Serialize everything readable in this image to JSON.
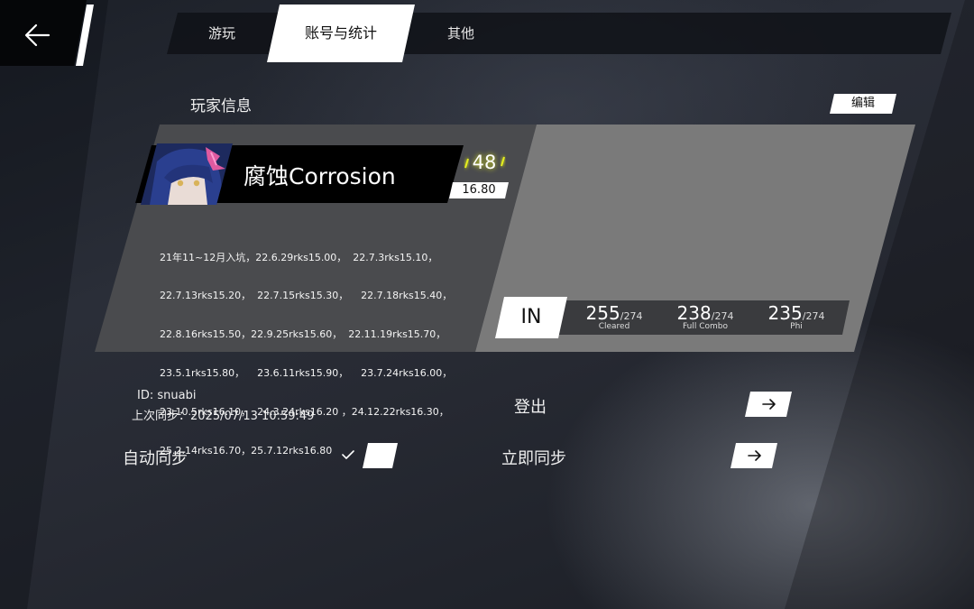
{
  "nav": {
    "tabs": [
      {
        "label": "游玩"
      },
      {
        "label": "账号与统计"
      },
      {
        "label": "其他"
      }
    ]
  },
  "profile": {
    "section_title": "玩家信息",
    "edit_label": "编辑",
    "player_name": "腐蚀Corrosion",
    "level": "48",
    "rks": "16.80",
    "bio_lines": [
      "21年11~12月入坑，22.6.29rks15.00，  22.7.3rks15.10，",
      "22.7.13rks15.20，  22.7.15rks15.30，    22.7.18rks15.40，",
      "22.8.16rks15.50，22.9.25rks15.60，  22.11.19rks15.70，",
      "23.5.1rks15.80，    23.6.11rks15.90，    23.7.24rks16.00，",
      "23.10.5rks16.10，  24.3.24rks16.20 ，24.12.22rks16.30，",
      "25.2.14rks16.70，25.7.12rks16.80"
    ],
    "difficulty": "IN",
    "stats": [
      {
        "value": "255",
        "total": "/274",
        "label": "Cleared"
      },
      {
        "value": "238",
        "total": "/274",
        "label": "Full Combo"
      },
      {
        "value": "235",
        "total": "/274",
        "label": "Phi"
      }
    ]
  },
  "account": {
    "id_line": "ID: snuabi",
    "sync_line": "上次同步：2025/07/13 10:59:49",
    "logout_label": "登出",
    "autosync_label": "自动同步",
    "autosync_enabled": true,
    "syncnow_label": "立即同步"
  },
  "colors": {
    "level_accent": "#e6f01e",
    "card_dark": "#4a4b4e",
    "card_light": "#7a7a7a"
  }
}
